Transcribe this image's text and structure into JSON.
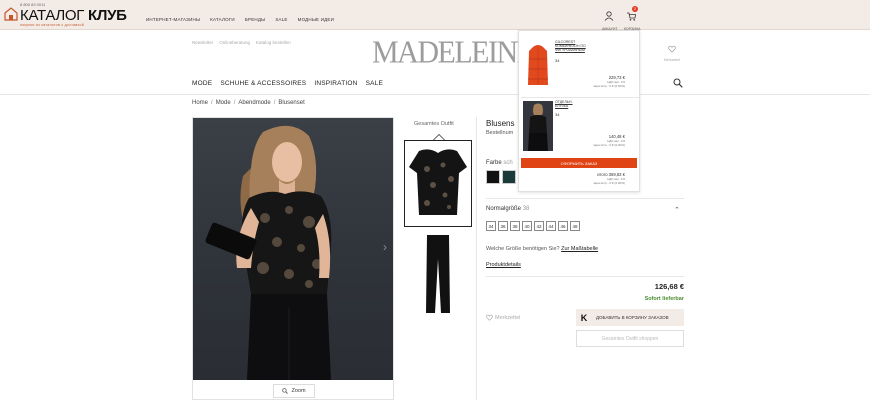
{
  "katalog": {
    "phone": "8 800 83 0011",
    "name_light": "КАТАЛОГ",
    "name_bold": "КЛУБ",
    "slogan": "покупки из каталогов с доставкой",
    "nav": [
      "ИНТЕРНЕТ-МАГАЗИНЫ",
      "КАТАЛОГИ",
      "БРЕНДЫ",
      "SALE",
      "МОДНЫЕ ИДЕИ"
    ],
    "account_label": "АККАУНТ",
    "cart_label": "КОРЗИНА",
    "cart_count": "2"
  },
  "store": {
    "brand": "MADELEINE",
    "util_links": [
      "Newsletter",
      "Onlineberatung",
      "Katalog bestellen"
    ],
    "wishlist_label": "Merkzettel",
    "main_nav": [
      "MODE",
      "SCHUHE & ACCESSOIRES",
      "INSPIRATION",
      "SALE"
    ]
  },
  "breadcrumb": [
    "Home",
    "Mode",
    "Abendmode",
    "Blusenset"
  ],
  "outfit": {
    "title": "Gesamtes Outfit"
  },
  "zoom_label": "Zoom",
  "product": {
    "title": "Blusens",
    "article_label": "Bestellnum",
    "color_label": "Farbe",
    "color_value": "sch",
    "size_label": "Normalgröße",
    "size_value": "38",
    "sizes": [
      "34",
      "36",
      "38",
      "40",
      "42",
      "44",
      "46",
      "48"
    ],
    "size_help": "Welche Größe benötigen Sie?",
    "size_help_link": "Zur Maßtabelle",
    "details_label": "Produktdetails",
    "price": "126,68 €",
    "availability": "Sofort lieferbar",
    "wishlist_label": "Merkzettel",
    "cart_button_k": "K",
    "cart_button": "ДОБАВИТЬ В КОРЗИНУ ЗАКАЗОВ",
    "outfit_button": "Gesamtes Outfit shoppen"
  },
  "minicart": {
    "items": [
      {
        "name_line1": "GILCOREST",
        "name_line2": "КОМБИНЕЗОН ПО",
        "name_line3": "ФИГУРОВАННЫМ",
        "size": "34",
        "price": "229,73 €",
        "vat_line1": "НДС вкл. 0 €",
        "vat_line2": "зарегистр.: 0 € (0,00%)"
      },
      {
        "name_line1": "ОТДЕЛЬН.",
        "name_line2": "БЛУЗКА",
        "size": "34",
        "price": "140,48 €",
        "vat_line1": "НДС вкл. 0 €",
        "vat_line2": "зарегистр.: 0 € (0,00%)"
      }
    ],
    "order_button": "ОФОРМИТЬ ЗАКАЗ",
    "total": "итого 369,83 €",
    "total_vat_line1": "НДС вкл. 0 €",
    "total_vat_line2": "зарегистр.: 0 € (0,00%)"
  },
  "colors": {
    "katalog_bar": "#f3ebe5",
    "order_accent": "#e04414",
    "available_green": "#4a8c30",
    "vest_orange": "#e24a1e"
  }
}
